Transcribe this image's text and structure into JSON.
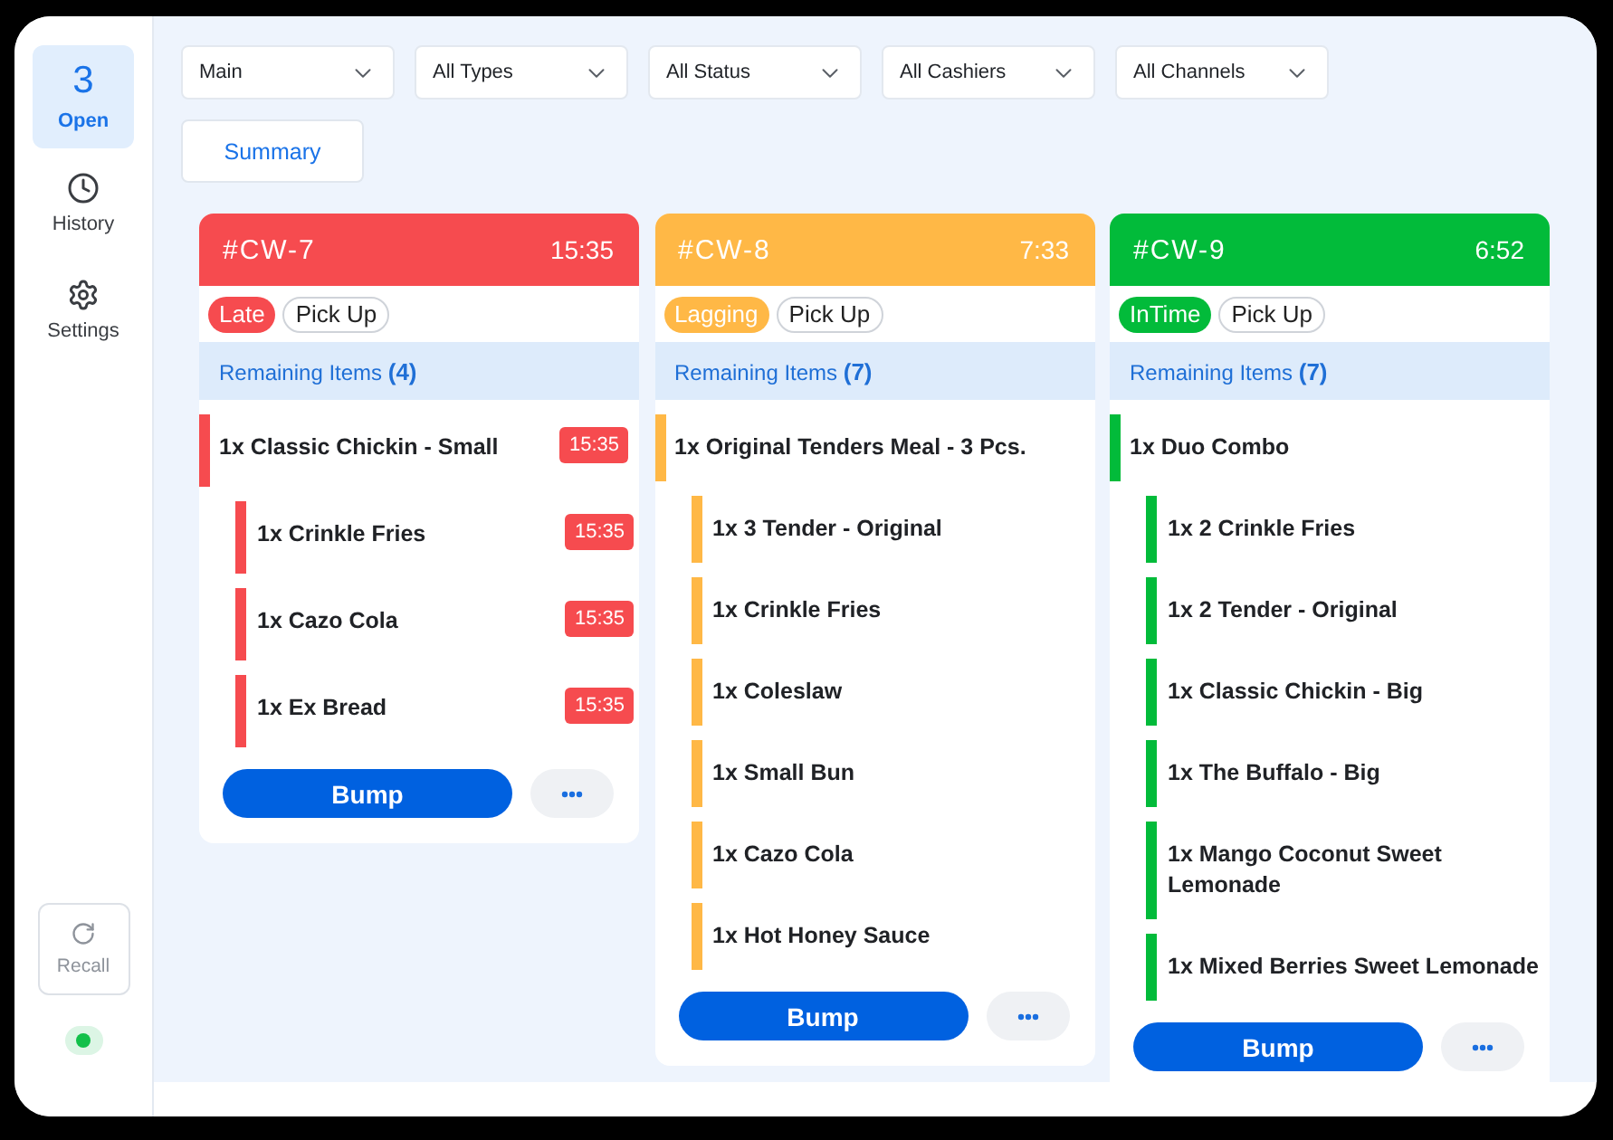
{
  "sidebar": {
    "items": [
      {
        "kind": "open",
        "count": "3",
        "label": "Open",
        "selected": true
      },
      {
        "kind": "history",
        "label": "History",
        "selected": false
      },
      {
        "kind": "settings",
        "label": "Settings",
        "selected": false
      }
    ],
    "recall": {
      "label": "Recall",
      "disabled": true
    },
    "connection": {
      "online": true
    }
  },
  "filters": [
    {
      "value": "Main"
    },
    {
      "value": "All Types"
    },
    {
      "value": "All Status"
    },
    {
      "value": "All Cashiers"
    },
    {
      "value": "All Channels"
    }
  ],
  "summary_button": "Summary",
  "orders": [
    {
      "number": "#CW-7",
      "timer": "15:35",
      "color": "#f64b4f",
      "status": "Late",
      "channel": "Pick Up",
      "remaining": "Remaining Items **(4)**",
      "items": [
        {
          "name": "1x Classic Chickin - Small",
          "time": "15:35",
          "children": [
            {
              "name": "1x Crinkle Fries",
              "time": "15:35"
            },
            {
              "name": "1x Cazo Cola",
              "time": "15:35"
            },
            {
              "name": "1x Ex Bread",
              "time": "15:35"
            }
          ]
        }
      ],
      "bump": "Bump"
    },
    {
      "number": "#CW-8",
      "timer": "7:33",
      "color": "#ffb846",
      "status": "Lagging",
      "channel": "Pick Up",
      "remaining": "Remaining Items **(7)**",
      "items": [
        {
          "name": "1x Original Tenders Meal - 3 Pcs.",
          "children": [
            {
              "name": "1x 3 Tender - Original"
            },
            {
              "name": "1x Crinkle Fries"
            },
            {
              "name": "1x Coleslaw"
            },
            {
              "name": "1x Small Bun"
            },
            {
              "name": "1x Cazo Cola"
            },
            {
              "name": "1x Hot Honey Sauce"
            }
          ]
        }
      ],
      "bump": "Bump"
    },
    {
      "number": "#CW-9",
      "timer": "6:52",
      "color": "#02bb3a",
      "status": "InTime",
      "channel": "Pick Up",
      "remaining": "Remaining Items **(7)**",
      "items": [
        {
          "name": "1x Duo Combo",
          "children": [
            {
              "name": "1x 2 Crinkle Fries"
            },
            {
              "name": "1x 2 Tender - Original"
            },
            {
              "name": "1x Classic Chickin - Big"
            },
            {
              "name": "1x The Buffalo - Big"
            },
            {
              "name": "1x Mango Coconut Sweet Lemonade"
            },
            {
              "name": "1x Mixed Berries Sweet Lemonade"
            }
          ]
        }
      ],
      "bump": "Bump"
    }
  ]
}
